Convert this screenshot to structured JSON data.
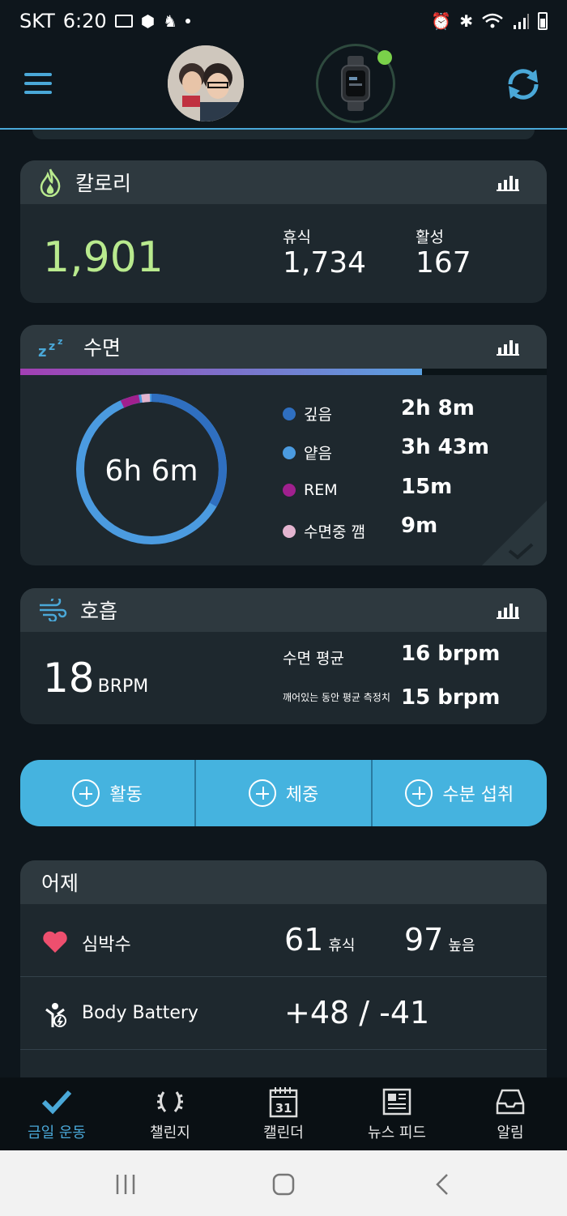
{
  "status_bar": {
    "carrier": "SKT",
    "time": "6:20"
  },
  "header": {
    "menu_icon": "hamburger-icon",
    "avatar": "user-avatar",
    "device": "watch-icon",
    "sync_icon": "sync-icon"
  },
  "calories": {
    "title": "칼로리",
    "total": "1,901",
    "resting_label": "휴식",
    "resting_value": "1,734",
    "active_label": "활성",
    "active_value": "167",
    "accent": "#b9ea8e"
  },
  "sleep": {
    "title": "수면",
    "total": "6h 6m",
    "stages": [
      {
        "label": "깊음",
        "value": "2h 8m",
        "color": "#2f6fc0"
      },
      {
        "label": "얕음",
        "value": "3h 43m",
        "color": "#4b9be0"
      },
      {
        "label": "REM",
        "value": "15m",
        "color": "#a0208e"
      },
      {
        "label": "수면중 깸",
        "value": "9m",
        "color": "#e3b4cf"
      }
    ]
  },
  "respiration": {
    "title": "호흡",
    "value": "18",
    "unit": "BRPM",
    "sleep_avg_label": "수면 평균",
    "sleep_avg_value": "16 brpm",
    "awake_avg_label": "깨어있는 동안 평균 측정치",
    "awake_avg_value": "15 brpm"
  },
  "quick_add": {
    "activity": "활동",
    "weight": "체중",
    "hydration": "수분 섭취"
  },
  "yesterday": {
    "title": "어제",
    "heart_rate": {
      "label": "심박수",
      "rest_value": "61",
      "rest_label": "휴식",
      "high_value": "97",
      "high_label": "높음"
    },
    "body_battery": {
      "label": "Body Battery",
      "value": "+48 / -41"
    }
  },
  "bottom_nav": {
    "today": "금일 운동",
    "challenges": "챌린지",
    "calendar": "캘린더",
    "calendar_day": "31",
    "news": "뉴스 피드",
    "notifications": "알림"
  },
  "colors": {
    "accent_blue": "#45b3df",
    "background": "#0e161c",
    "card": "#1e282e"
  }
}
